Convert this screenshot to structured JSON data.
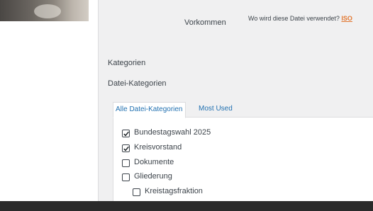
{
  "usage": {
    "label": "Vorkommen",
    "question": "Wo wird diese Datei verwendet?",
    "link": "ISO"
  },
  "categories_label": "Kategorien",
  "file_categories_label": "Datei-Kategorien",
  "tabs": [
    {
      "label": "Alle Datei-Kategorien",
      "active": true
    },
    {
      "label": "Most Used",
      "active": false
    }
  ],
  "items": [
    {
      "label": "Bundestagswahl 2025",
      "checked": true
    },
    {
      "label": "Kreisvorstand",
      "checked": true
    },
    {
      "label": "Dokumente",
      "checked": false
    },
    {
      "label": "Gliederung",
      "checked": false
    },
    {
      "label": "Kreistagsfraktion",
      "checked": false
    }
  ],
  "colors": {
    "link_accent": "#e27730",
    "tab_link": "#2271b1",
    "background": "#f0f0f1"
  }
}
